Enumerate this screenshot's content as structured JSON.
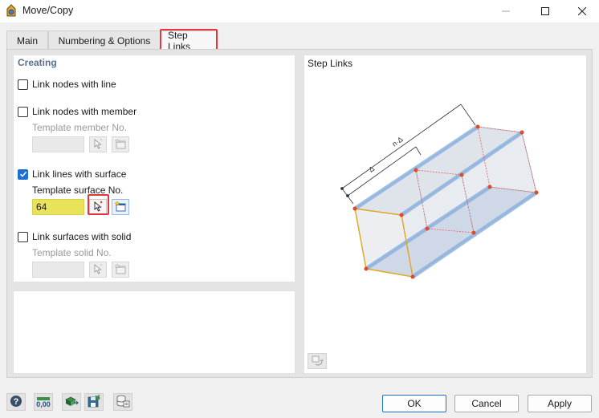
{
  "window": {
    "title": "Move/Copy"
  },
  "tabs": [
    {
      "label": "Main"
    },
    {
      "label": "Numbering & Options"
    },
    {
      "label": "Step Links"
    }
  ],
  "creating": {
    "section_title": "Creating",
    "link_nodes_line": {
      "label": "Link nodes with line",
      "checked": false
    },
    "link_nodes_member": {
      "label": "Link nodes with member",
      "checked": false,
      "template_label": "Template member No.",
      "template_value": ""
    },
    "link_lines_surface": {
      "label": "Link lines with surface",
      "checked": true,
      "template_label": "Template surface No.",
      "template_value": "64"
    },
    "link_surfaces_solid": {
      "label": "Link surfaces with solid",
      "checked": false,
      "template_label": "Template solid No.",
      "template_value": ""
    }
  },
  "preview": {
    "title": "Step Links",
    "dim_label_n": "n·Δ",
    "dim_label_d": "Δ"
  },
  "footer": {
    "ok_label": "OK",
    "cancel_label": "Cancel",
    "apply_label": "Apply",
    "units_label": "0,00"
  },
  "icons": [
    "help-icon",
    "units-icon",
    "model-view-icon",
    "save-icon",
    "library-icon",
    "pick-icon",
    "new-item-icon",
    "rotate-view-icon"
  ]
}
